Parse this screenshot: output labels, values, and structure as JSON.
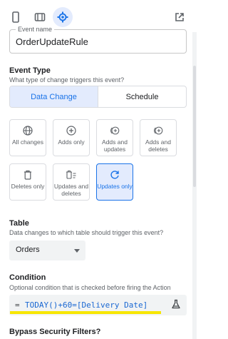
{
  "toolbar": {
    "icons": [
      "phone-icon",
      "tablet-icon",
      "settings-icon",
      "open-external-icon"
    ],
    "accent": "#1a73e8"
  },
  "event_name": {
    "label": "Event name",
    "value": "OrderUpdateRule"
  },
  "event_type": {
    "title": "Event Type",
    "description": "What type of change triggers this event?",
    "options": [
      {
        "label": "Data Change",
        "selected": true
      },
      {
        "label": "Schedule",
        "selected": false
      }
    ]
  },
  "change_types": [
    {
      "label": "All changes",
      "icon": "globe-icon",
      "selected": false
    },
    {
      "label": "Adds only",
      "icon": "add-circle-icon",
      "selected": false
    },
    {
      "label": "Adds and updates",
      "icon": "add-update-icon",
      "selected": false
    },
    {
      "label": "Adds and deletes",
      "icon": "add-delete-icon",
      "selected": false
    },
    {
      "label": "Deletes only",
      "icon": "trash-icon",
      "selected": false
    },
    {
      "label": "Updates and deletes",
      "icon": "update-delete-icon",
      "selected": false
    },
    {
      "label": "Updates only",
      "icon": "refresh-icon",
      "selected": true
    }
  ],
  "table": {
    "title": "Table",
    "description": "Data changes to which table should trigger this event?",
    "selected": "Orders"
  },
  "condition": {
    "title": "Condition",
    "description": "Optional condition that is checked before firing the Action",
    "prefix": "=",
    "expression": "TODAY()+60=[Delivery Date]",
    "test_icon": "flask-icon"
  },
  "bypass": {
    "title": "Bypass Security Filters?"
  }
}
